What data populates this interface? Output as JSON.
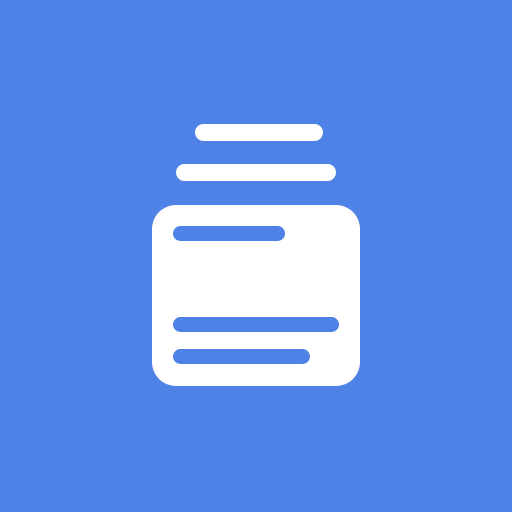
{
  "app_icon": {
    "icon": "stacked-cards-icon",
    "colors": {
      "background": "#4f82e6",
      "foreground": "#ffffff",
      "accent": "#4f82e6"
    }
  }
}
